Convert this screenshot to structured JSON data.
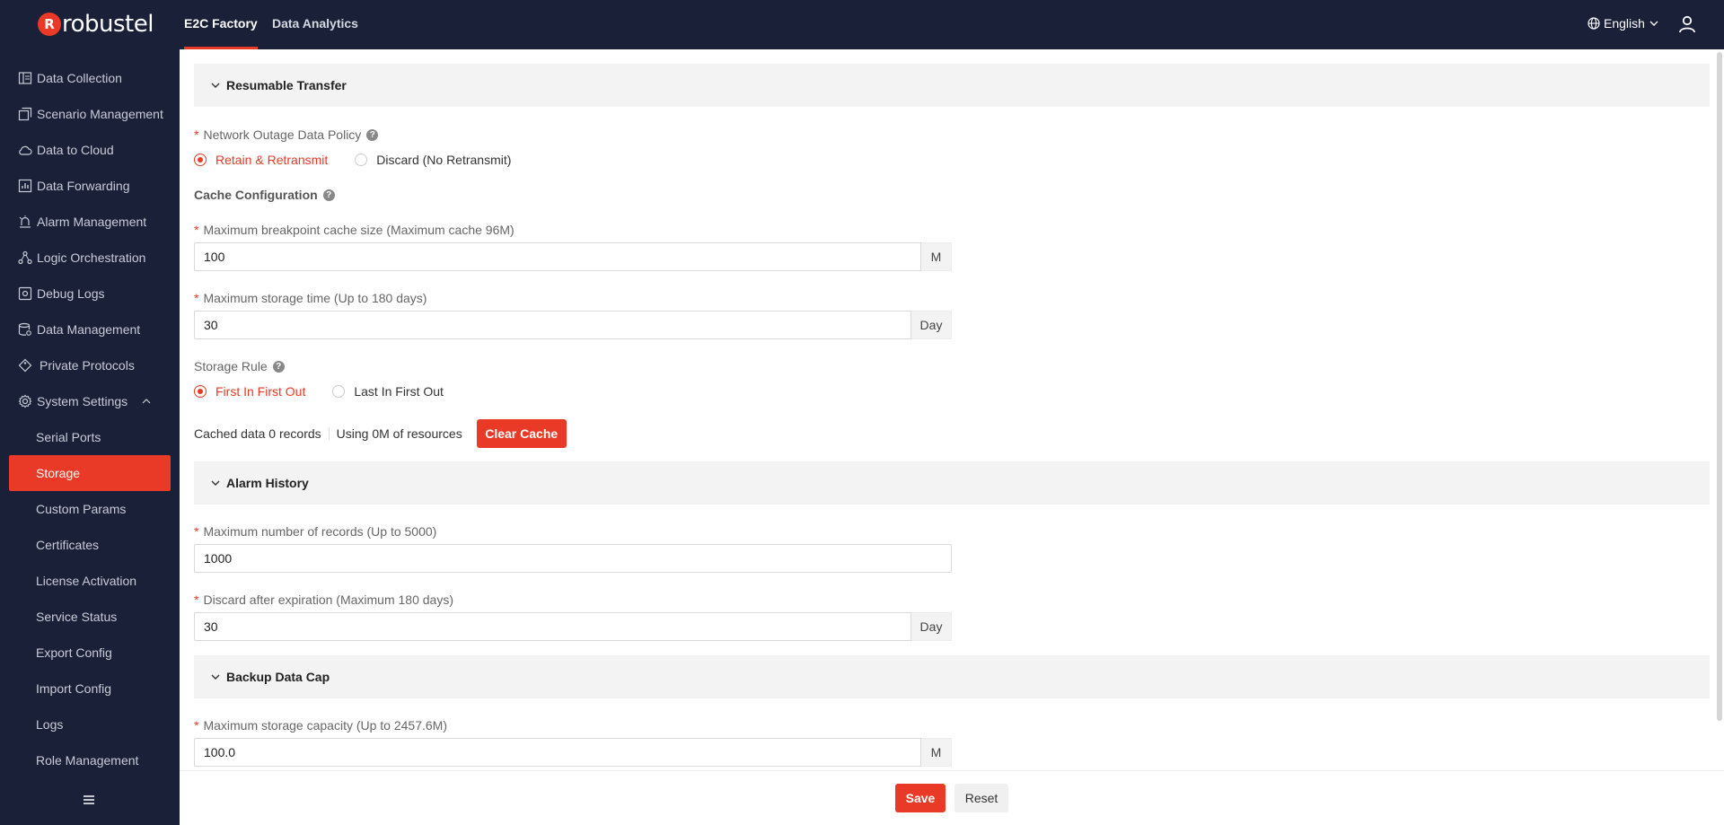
{
  "header": {
    "logo_text": "robustel",
    "logo_mark": "R",
    "tabs": [
      {
        "label": "E2C Factory",
        "active": true
      },
      {
        "label": "Data Analytics",
        "active": false
      }
    ],
    "language": "English"
  },
  "sidebar": {
    "items": [
      {
        "label": "Data Collection",
        "icon": "data-collection-icon"
      },
      {
        "label": "Scenario Management",
        "icon": "scenario-icon"
      },
      {
        "label": "Data to Cloud",
        "icon": "cloud-icon"
      },
      {
        "label": "Data Forwarding",
        "icon": "forwarding-icon"
      },
      {
        "label": "Alarm Management",
        "icon": "alarm-icon"
      },
      {
        "label": "Logic Orchestration",
        "icon": "logic-icon"
      },
      {
        "label": "Debug Logs",
        "icon": "debug-icon"
      },
      {
        "label": "Data Management",
        "icon": "database-icon"
      },
      {
        "label": "Private Protocols",
        "icon": "protocol-icon"
      },
      {
        "label": "System Settings",
        "icon": "gear-icon"
      }
    ],
    "sub_items": [
      {
        "label": "Serial Ports"
      },
      {
        "label": "Storage",
        "active": true
      },
      {
        "label": "Custom Params"
      },
      {
        "label": "Certificates"
      },
      {
        "label": "License Activation"
      },
      {
        "label": "Service Status"
      },
      {
        "label": "Export Config"
      },
      {
        "label": "Import Config"
      },
      {
        "label": "Logs"
      },
      {
        "label": "Role Management"
      }
    ]
  },
  "resumable": {
    "title": "Resumable Transfer",
    "policy_label": "Network Outage Data Policy",
    "policy_options": [
      "Retain & Retransmit",
      "Discard (No Retransmit)"
    ],
    "policy_selected": 0,
    "cache_config_label": "Cache Configuration",
    "max_cache_label": "Maximum breakpoint cache size (Maximum cache 96M)",
    "max_cache_value": "100",
    "max_cache_unit": "M",
    "max_time_label": "Maximum storage time (Up to 180 days)",
    "max_time_value": "30",
    "max_time_unit": "Day",
    "storage_rule_label": "Storage Rule",
    "storage_rule_options": [
      "First In First Out",
      "Last In First Out"
    ],
    "storage_rule_selected": 0,
    "cached_records": "Cached data 0 records",
    "resources_used": "Using 0M of resources",
    "clear_cache_label": "Clear Cache"
  },
  "alarm_history": {
    "title": "Alarm History",
    "max_records_label": "Maximum number of records (Up to 5000)",
    "max_records_value": "1000",
    "discard_label": "Discard after expiration (Maximum 180 days)",
    "discard_value": "30",
    "discard_unit": "Day"
  },
  "backup": {
    "title": "Backup Data Cap",
    "max_capacity_label": "Maximum storage capacity (Up to 2457.6M)",
    "max_capacity_value": "100.0",
    "max_capacity_unit": "M"
  },
  "footer": {
    "save_label": "Save",
    "reset_label": "Reset"
  },
  "colors": {
    "accent": "#e83a26",
    "nav_bg": "#1a2038"
  }
}
